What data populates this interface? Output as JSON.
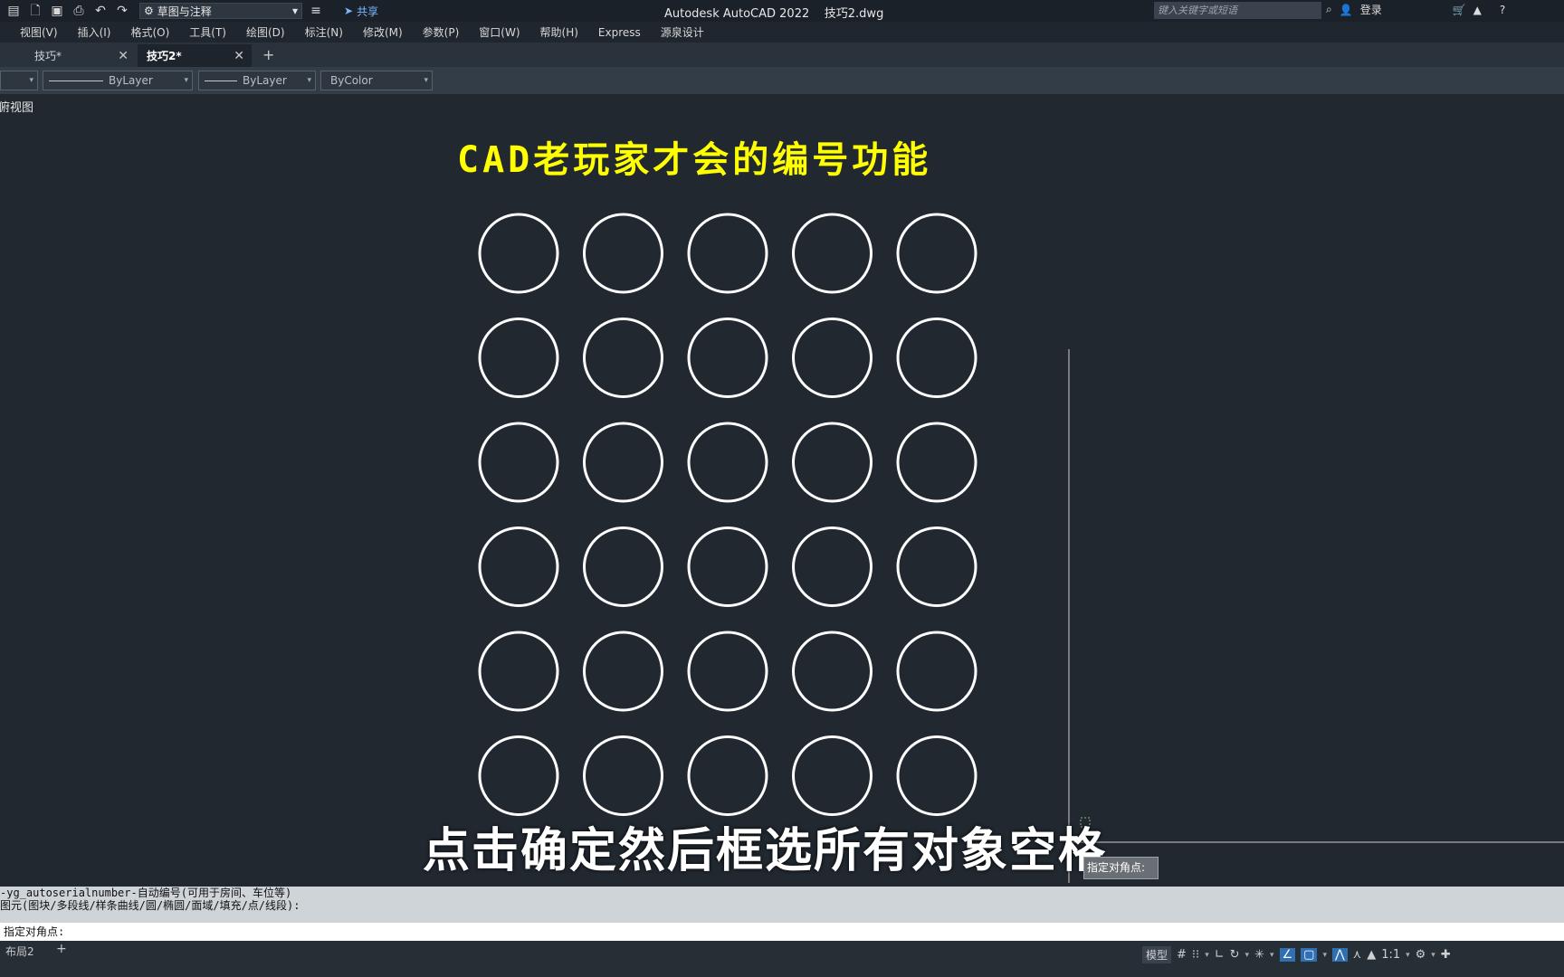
{
  "titlebar": {
    "workspace": "草图与注释",
    "share": "共享",
    "app_title": "Autodesk AutoCAD 2022    技巧2.dwg",
    "search_placeholder": "键入关键字或短语",
    "login": "登录"
  },
  "menu": [
    "视图(V)",
    "插入(I)",
    "格式(O)",
    "工具(T)",
    "绘图(D)",
    "标注(N)",
    "修改(M)",
    "参数(P)",
    "窗口(W)",
    "帮助(H)",
    "Express",
    "源泉设计"
  ],
  "tabs": [
    {
      "label": "技巧*",
      "active": false
    },
    {
      "label": "技巧2*",
      "active": true
    }
  ],
  "properties": {
    "linetype": "ByLayer",
    "lineweight": "ByLayer",
    "color": "ByColor"
  },
  "viewport_label": "俯视图",
  "drawing": {
    "title": "CAD老玩家才会的编号功能",
    "circle_rows": 6,
    "circle_cols": 5,
    "circle_color": "#ffffff",
    "title_color": "#ffff00"
  },
  "subtitle": "点击确定然后框选所有对象空格",
  "tooltip": "指定对角点:",
  "command_history": [
    "-yg_autoserialnumber-自动编号(可用于房间、车位等)",
    "图元(图块/多段线/样条曲线/圆/椭圆/面域/填充/点/线段):"
  ],
  "command_prompt": "指定对角点:",
  "statusbar": {
    "layout_tab": "布局2",
    "model": "模型",
    "scale": "1:1"
  }
}
